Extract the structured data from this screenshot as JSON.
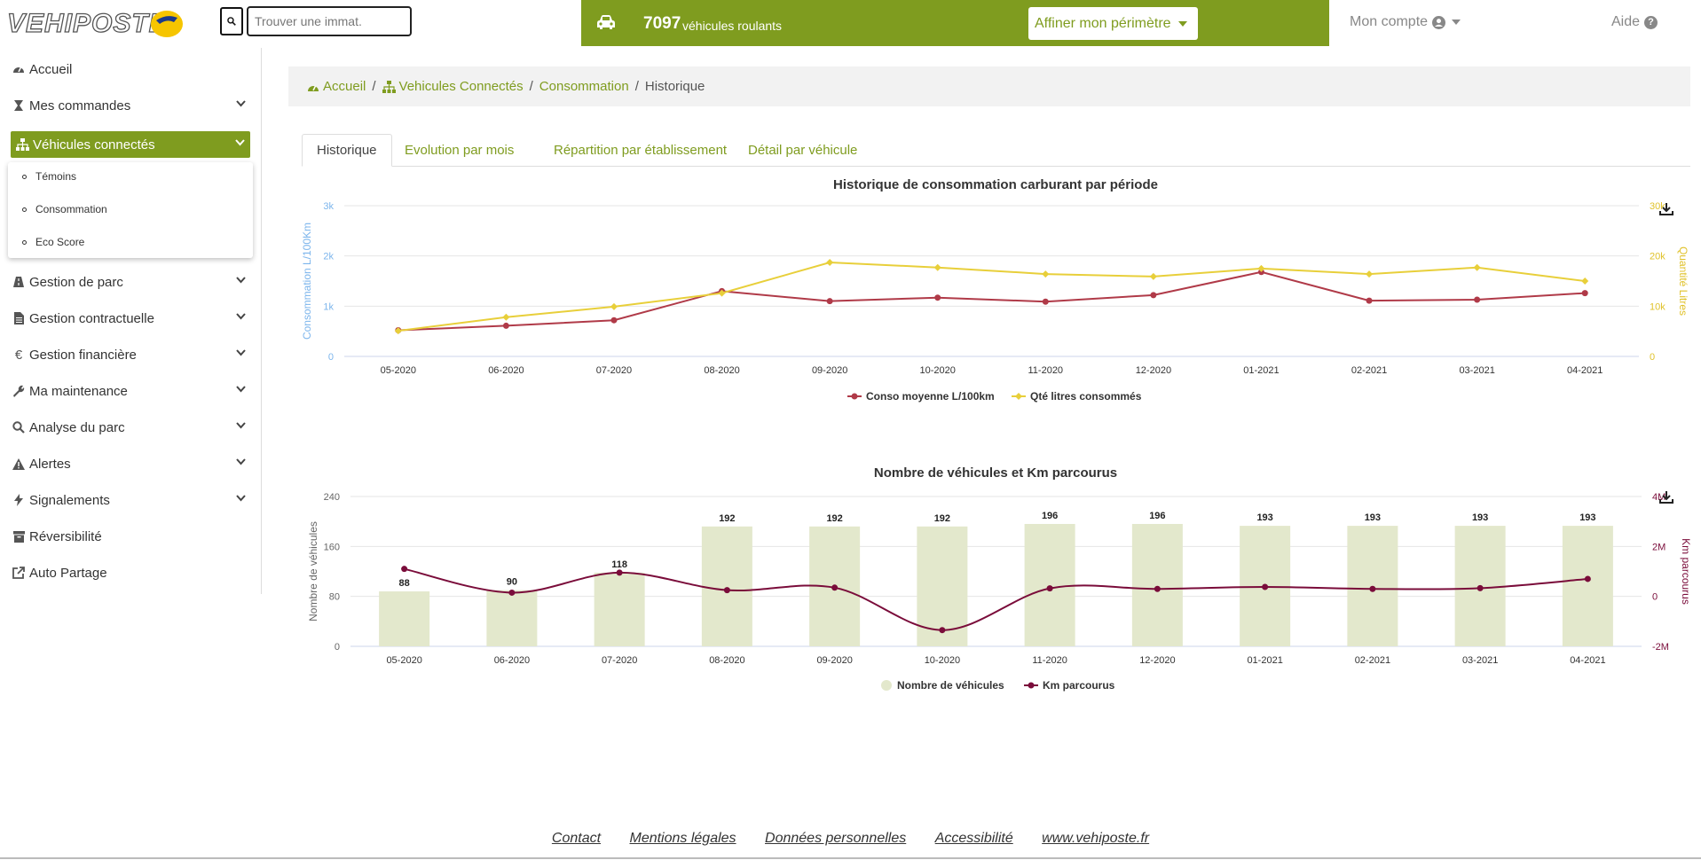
{
  "header": {
    "logo_text": "VEHIPOSTE",
    "search_placeholder": "Trouver une immat.",
    "vehicle_count": "7097",
    "vehicle_label": "véhicules roulants",
    "scope_button": "Affiner mon périmètre",
    "account": "Mon compte",
    "help": "Aide"
  },
  "colors": {
    "brand_green": "#7f9c1f",
    "conso_red": "#b03a48",
    "litres_yellow": "#e8cf3a",
    "km_purple": "#7a0c3a",
    "bar_fill": "#e3e8cc"
  },
  "sidebar": {
    "items": [
      {
        "label": "Accueil",
        "icon": "dashboard-icon"
      },
      {
        "label": "Mes commandes",
        "icon": "hourglass-icon"
      },
      {
        "label": "Véhicules connectés",
        "icon": "sitemap-icon"
      },
      {
        "label": "Gestion de parc",
        "icon": "road-icon"
      },
      {
        "label": "Gestion contractuelle",
        "icon": "file-icon"
      },
      {
        "label": "Gestion financière",
        "icon": "euro-icon"
      },
      {
        "label": "Ma maintenance",
        "icon": "wrench-icon"
      },
      {
        "label": "Analyse du parc",
        "icon": "search-icon"
      },
      {
        "label": "Alertes",
        "icon": "warning-icon"
      },
      {
        "label": "Signalements",
        "icon": "bolt-icon"
      },
      {
        "label": "Réversibilité",
        "icon": "archive-icon"
      },
      {
        "label": "Auto Partage",
        "icon": "external-link-icon"
      }
    ],
    "submenu": [
      "Témoins",
      "Consommation",
      "Eco Score"
    ]
  },
  "breadcrumb": {
    "home": "Accueil",
    "section": "Vehicules Connectés",
    "page": "Consommation",
    "current": "Historique"
  },
  "tabs": [
    "Historique",
    "Evolution par mois",
    "Répartition par établissement",
    "Détail par véhicule"
  ],
  "chart_data": [
    {
      "type": "line",
      "title": "Historique de consommation carburant par période",
      "categories": [
        "05-2020",
        "06-2020",
        "07-2020",
        "08-2020",
        "09-2020",
        "10-2020",
        "11-2020",
        "12-2020",
        "01-2021",
        "02-2021",
        "03-2021",
        "04-2021"
      ],
      "y_left": {
        "label": "Consommation L/100Km",
        "ticks": [
          "0",
          "1k",
          "2k",
          "3k"
        ],
        "range": [
          0,
          3000
        ]
      },
      "y_right": {
        "label": "Quantité Litres",
        "ticks": [
          "0",
          "10k",
          "20k",
          "30k"
        ],
        "range": [
          0,
          30000
        ]
      },
      "series": [
        {
          "name": "Conso moyenne L/100km",
          "axis": "left",
          "values": [
            520,
            610,
            720,
            1300,
            1100,
            1170,
            1090,
            1220,
            1680,
            1110,
            1130,
            1260
          ]
        },
        {
          "name": "Qté litres consommés",
          "axis": "right",
          "values": [
            5100,
            7800,
            9900,
            12600,
            18700,
            17700,
            16400,
            15900,
            17500,
            16400,
            17700,
            15000
          ]
        }
      ],
      "legend": "bottom-center",
      "grid": true
    },
    {
      "type": "bar",
      "title": "Nombre de véhicules et Km parcourus",
      "categories": [
        "05-2020",
        "06-2020",
        "07-2020",
        "08-2020",
        "09-2020",
        "10-2020",
        "11-2020",
        "12-2020",
        "01-2021",
        "02-2021",
        "03-2021",
        "04-2021"
      ],
      "y_left": {
        "label": "Nombre de véhicules",
        "ticks": [
          "0",
          "80",
          "160",
          "240"
        ],
        "range": [
          0,
          240
        ]
      },
      "y_right": {
        "label": "Km parcourus",
        "ticks": [
          "-2M",
          "0",
          "2M",
          "4M"
        ],
        "range": [
          -2000000,
          4000000
        ]
      },
      "series": [
        {
          "name": "Nombre de véhicules",
          "kind": "bar",
          "axis": "left",
          "values": [
            88,
            90,
            118,
            192,
            192,
            192,
            196,
            196,
            193,
            193,
            193,
            193
          ],
          "labels": [
            "88",
            "90",
            "118",
            "192",
            "192",
            "192",
            "196",
            "196",
            "193",
            "193",
            "193",
            "193"
          ]
        },
        {
          "name": "Km parcourus",
          "kind": "spline",
          "axis": "right",
          "values": [
            1100000,
            150000,
            950000,
            250000,
            350000,
            -1350000,
            320000,
            300000,
            380000,
            300000,
            330000,
            700000
          ]
        }
      ],
      "legend": "bottom-center",
      "grid": true
    }
  ],
  "footer": {
    "links": [
      "Contact",
      "Mentions légales",
      "Données personnelles",
      "Accessibilité",
      "www.vehiposte.fr"
    ]
  }
}
